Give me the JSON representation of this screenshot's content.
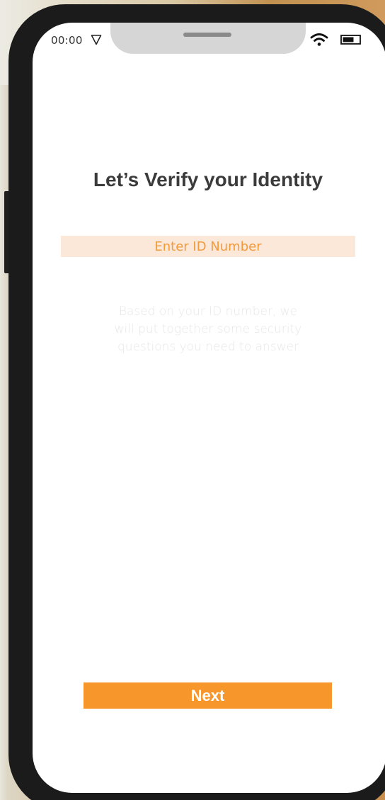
{
  "status_bar": {
    "time": "00:00",
    "icons": [
      "location-arrow-icon",
      "wifi-icon",
      "battery-icon"
    ]
  },
  "verify": {
    "title": "Let’s Verify your Identity",
    "id_placeholder": "Enter ID Number",
    "id_value": "",
    "helper_text": "Based on your ID number, we will put together some security questions you need to answer",
    "next_label": "Next"
  },
  "colors": {
    "accent": "#f7962a",
    "input_background": "#fbe8d8",
    "input_text": "#f29a3c",
    "title_text": "#3b3b3b",
    "helper_text": "#e7e7e7"
  }
}
